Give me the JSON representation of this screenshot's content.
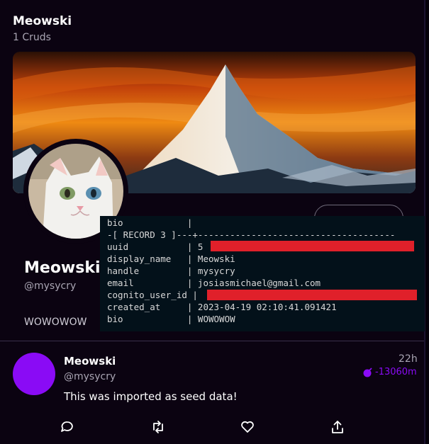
{
  "header": {
    "name": "Meowski",
    "count": "1 Cruds"
  },
  "profile": {
    "display_name": "Meowski",
    "handle": "@mysycry",
    "bio": "WOWOWOW"
  },
  "terminal": {
    "lines": [
      "bio            |",
      "-[ RECORD 3 ]---+-------------------------------------",
      "uuid           | 5",
      "display_name   | Meowski",
      "handle         | mysycry",
      "email          | josiasmichael@gmail.com",
      "cognito_user_id |",
      "created_at     | 2023-04-19 02:10:41.091421",
      "bio            | WOWOWOW"
    ]
  },
  "post": {
    "display_name": "Meowski",
    "handle": "@mysycry",
    "time": "22h",
    "expires": "-13060m",
    "message": "This was imported as seed data!"
  },
  "actions": {
    "reply_icon": "reply-icon",
    "repost_icon": "repost-icon",
    "like_icon": "heart-icon",
    "share_icon": "share-icon"
  },
  "colors": {
    "accent": "#8a0bf5",
    "background": "#0b0311",
    "redaction": "#e0202a"
  }
}
